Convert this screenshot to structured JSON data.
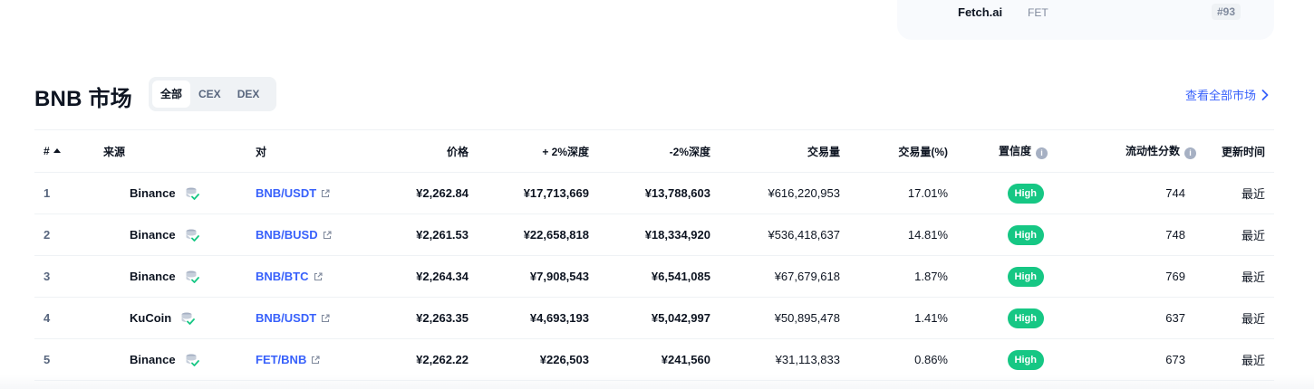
{
  "top_card": {
    "coin_name": "Fetch.ai",
    "coin_symbol": "FET",
    "rank": "#93"
  },
  "section": {
    "title": "BNB 市场",
    "filter_tabs": [
      "全部",
      "CEX",
      "DEX"
    ],
    "active_tab": "全部",
    "view_all": "查看全部市场"
  },
  "table": {
    "headers": {
      "num": "#",
      "source": "来源",
      "pair": "对",
      "price": "价格",
      "depth_plus": "+ 2%深度",
      "depth_minus": "-2%深度",
      "volume": "交易量",
      "volume_pct": "交易量(%)",
      "confidence": "置信度",
      "liquidity": "流动性分数",
      "updated": "更新时间"
    },
    "rows": [
      {
        "num": "1",
        "source": "Binance",
        "pair": "BNB/USDT",
        "price": "¥2,262.84",
        "depth_plus": "¥17,713,669",
        "depth_minus": "¥13,788,603",
        "volume": "¥616,220,953",
        "volume_pct": "17.01%",
        "confidence": "High",
        "liquidity": "744",
        "updated": "最近"
      },
      {
        "num": "2",
        "source": "Binance",
        "pair": "BNB/BUSD",
        "price": "¥2,261.53",
        "depth_plus": "¥22,658,818",
        "depth_minus": "¥18,334,920",
        "volume": "¥536,418,637",
        "volume_pct": "14.81%",
        "confidence": "High",
        "liquidity": "748",
        "updated": "最近"
      },
      {
        "num": "3",
        "source": "Binance",
        "pair": "BNB/BTC",
        "price": "¥2,264.34",
        "depth_plus": "¥7,908,543",
        "depth_minus": "¥6,541,085",
        "volume": "¥67,679,618",
        "volume_pct": "1.87%",
        "confidence": "High",
        "liquidity": "769",
        "updated": "最近"
      },
      {
        "num": "4",
        "source": "KuCoin",
        "pair": "BNB/USDT",
        "price": "¥2,263.35",
        "depth_plus": "¥4,693,193",
        "depth_minus": "¥5,042,997",
        "volume": "¥50,895,478",
        "volume_pct": "1.41%",
        "confidence": "High",
        "liquidity": "637",
        "updated": "最近"
      },
      {
        "num": "5",
        "source": "Binance",
        "pair": "FET/BNB",
        "price": "¥2,262.22",
        "depth_plus": "¥226,503",
        "depth_minus": "¥241,560",
        "volume": "¥31,113,833",
        "volume_pct": "0.86%",
        "confidence": "High",
        "liquidity": "673",
        "updated": "最近"
      }
    ]
  },
  "colors": {
    "accent_blue": "#3861fb",
    "high_badge": "#16c784",
    "text_primary": "#0d1421",
    "text_secondary": "#58667e"
  },
  "icons": {
    "sort": "sort-up-icon",
    "info": "info-icon",
    "database_check": "database-check-icon",
    "external_link": "external-link-icon",
    "chevron_right": "chevron-right-icon"
  }
}
